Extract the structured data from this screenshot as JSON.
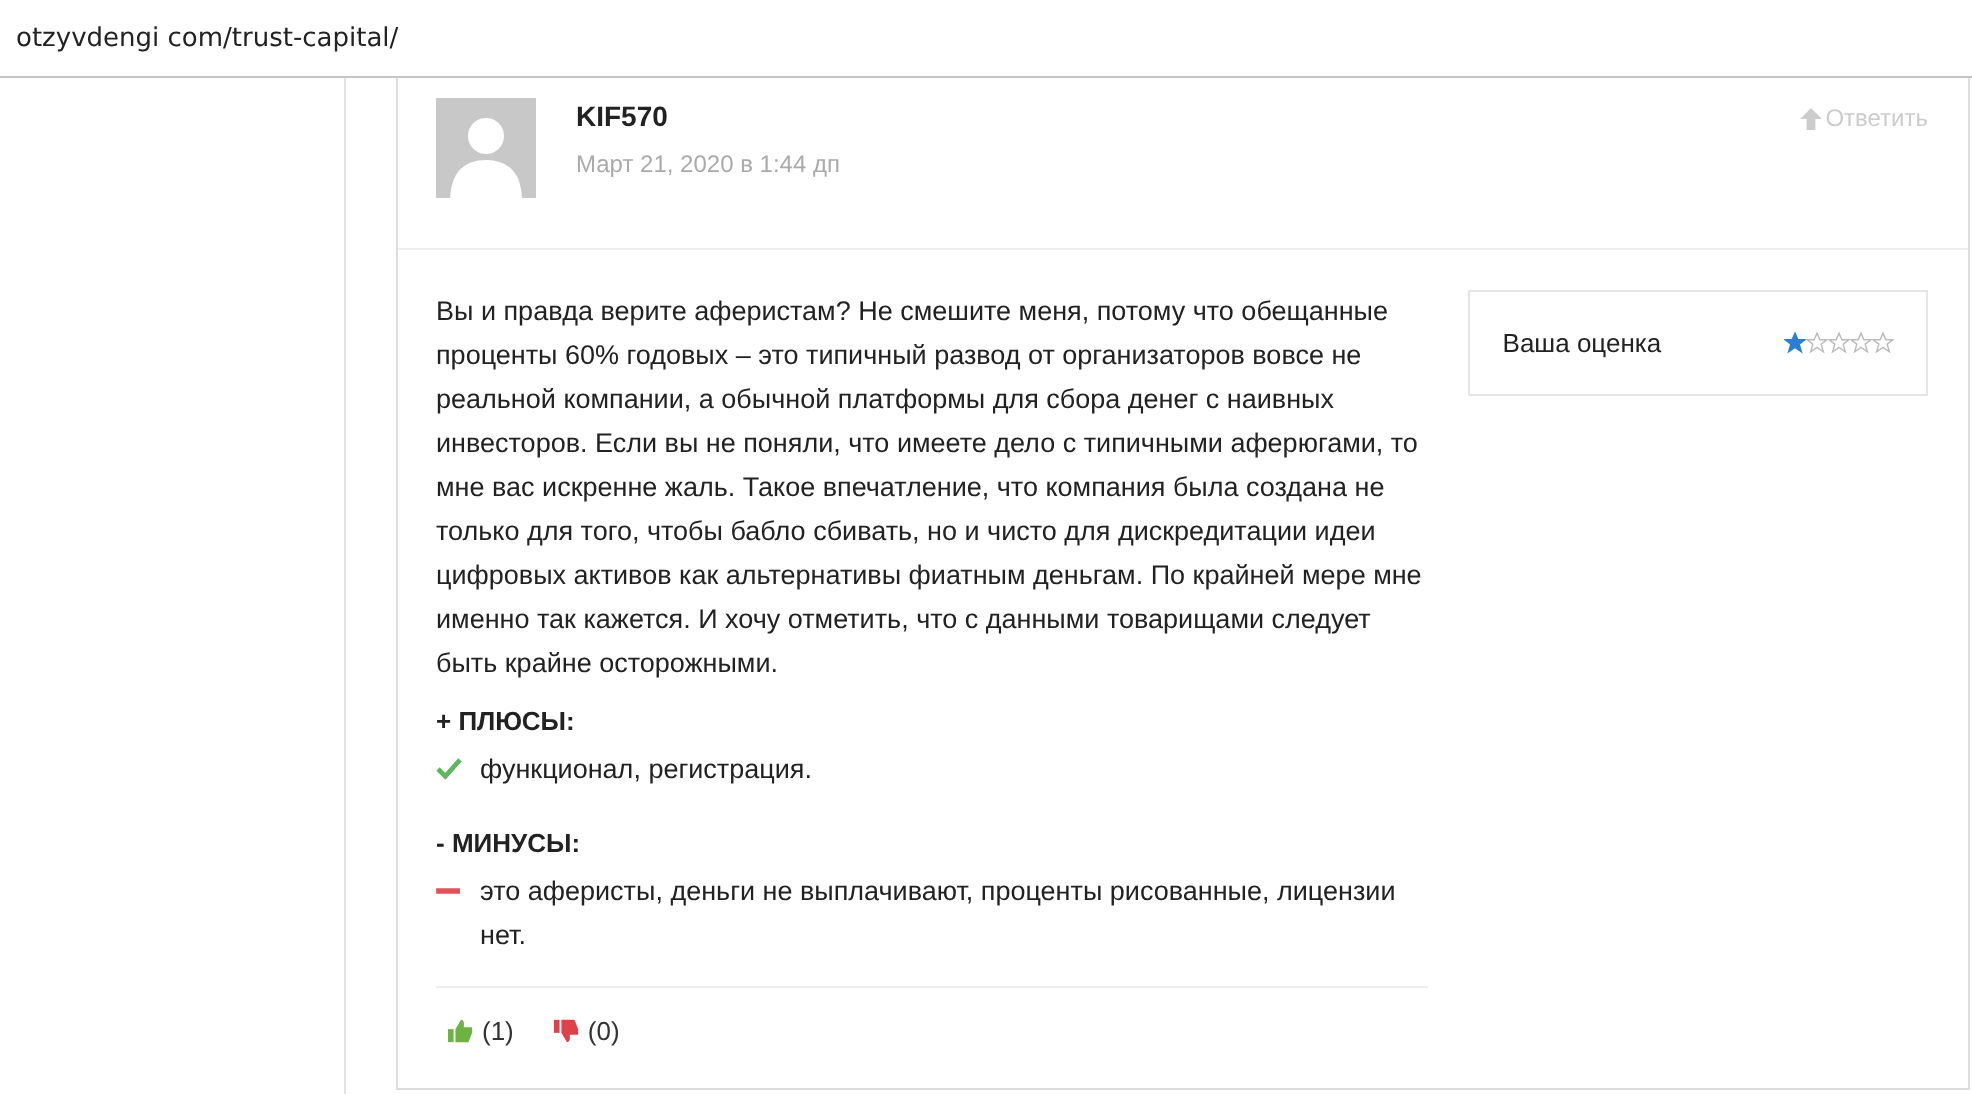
{
  "address_bar": {
    "url": "otzyvdengi com/trust-capital/"
  },
  "comment": {
    "author": "KIF570",
    "date": "Март 21, 2020 в 1:44 дп",
    "reply": "Ответить",
    "text": "Вы и правда верите аферистам? Не смешите меня, потому что обещанные проценты 60% годовых – это типичный развод от организаторов вовсе не реальной компании, а обычной платформы для сбора денег с наивных инвесторов. Если вы не поняли, что имеете дело с типичными аферюгами, то мне вас искренне жаль. Такое впечатление, что компания была создана не только для того, чтобы бабло сбивать, но и чисто для дискредитации идеи цифровых активов как альтернативы фиатным деньгам. По крайней мере мне именно так кажется. И хочу отметить, что с данными товарищами следует быть крайне осторожными.",
    "rating": {
      "label": "Ваша оценка",
      "stars": 1
    },
    "sections": [
      {
        "kind": "pros",
        "title": "+ ПЛЮСЫ:",
        "text": "функционал, регистрация."
      },
      {
        "kind": "cons",
        "title": "- МИНУСЫ:",
        "text": "это аферисты, деньги не выплачивают, проценты рисованные, лицензии нет."
      }
    ],
    "votes": [
      {
        "kind": "up",
        "count": "(1)"
      },
      {
        "kind": "down",
        "count": "(0)"
      }
    ]
  }
}
